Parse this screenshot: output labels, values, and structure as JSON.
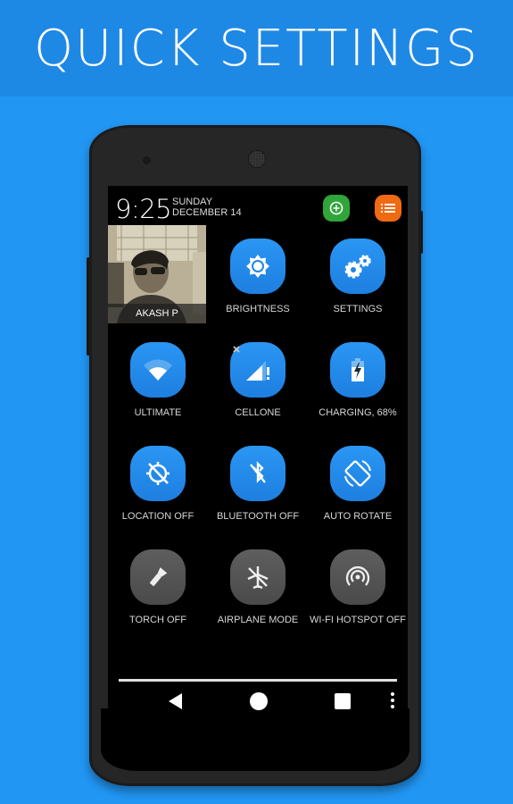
{
  "banner": {
    "title": "QUICK SETTINGS"
  },
  "status": {
    "time": "9:25",
    "day": "SUNDAY",
    "date": "DECEMBER 14",
    "add_button_icon": "plus-circle-icon",
    "menu_button_icon": "list-icon",
    "add_button_color": "#2fa53a",
    "menu_button_color": "#f06a12"
  },
  "profile": {
    "name": "AKASH P"
  },
  "tiles": [
    {
      "label": "BRIGHTNESS",
      "icon": "brightness-icon",
      "state": "on"
    },
    {
      "label": "SETTINGS",
      "icon": "gears-icon",
      "state": "on"
    },
    {
      "label": "ULTIMATE",
      "icon": "wifi-icon",
      "state": "on"
    },
    {
      "label": "CELLONE",
      "icon": "cell-signal-icon",
      "state": "on"
    },
    {
      "label": "CHARGING, 68%",
      "icon": "battery-charging-icon",
      "state": "on"
    },
    {
      "label": "LOCATION OFF",
      "icon": "location-off-icon",
      "state": "on"
    },
    {
      "label": "BLUETOOTH OFF",
      "icon": "bluetooth-off-icon",
      "state": "on"
    },
    {
      "label": "AUTO ROTATE",
      "icon": "auto-rotate-icon",
      "state": "on"
    },
    {
      "label": "TORCH OFF",
      "icon": "torch-icon",
      "state": "off"
    },
    {
      "label": "AIRPLANE MODE",
      "icon": "airplane-off-icon",
      "state": "off"
    },
    {
      "label": "WI-FI HOTSPOT OFF",
      "icon": "hotspot-icon",
      "state": "off"
    }
  ],
  "colors": {
    "accent": "#2196f3",
    "banner": "#1e88e5",
    "tile_on": "#1e88e5",
    "tile_off": "#555555"
  },
  "navbar": {
    "back": "back-icon",
    "home": "home-icon",
    "recents": "recents-icon",
    "more": "more-vert-icon"
  }
}
